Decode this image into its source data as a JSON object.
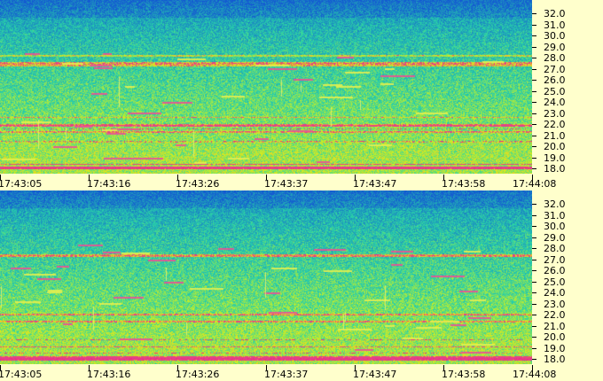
{
  "panels": [
    {
      "id": "top",
      "y_ticks": [
        "32.0",
        "31.0",
        "30.0",
        "29.0",
        "28.0",
        "27.0",
        "26.0",
        "25.0",
        "24.0",
        "23.0",
        "22.0",
        "21.0",
        "20.0",
        "19.0",
        "18.0"
      ],
      "x_ticks": [
        "17:43:05",
        "17:43:16",
        "17:43:26",
        "17:43:37",
        "17:43:47",
        "17:43:58",
        "17:44:08"
      ]
    },
    {
      "id": "bottom",
      "y_ticks": [
        "32.0",
        "31.0",
        "30.0",
        "29.0",
        "28.0",
        "27.0",
        "26.0",
        "25.0",
        "24.0",
        "23.0",
        "22.0",
        "21.0",
        "20.0",
        "19.0",
        "18.0"
      ],
      "x_ticks": [
        "17:43:05",
        "17:43:16",
        "17:43:26",
        "17:43:37",
        "17:43:47",
        "17:43:58",
        "17:44:08"
      ]
    }
  ],
  "colors": {
    "background": "#ffffcc",
    "low": "#1a6fd6",
    "mid": "#26c9a8",
    "high": "#c8f03c",
    "peak": "#e0307a"
  }
}
